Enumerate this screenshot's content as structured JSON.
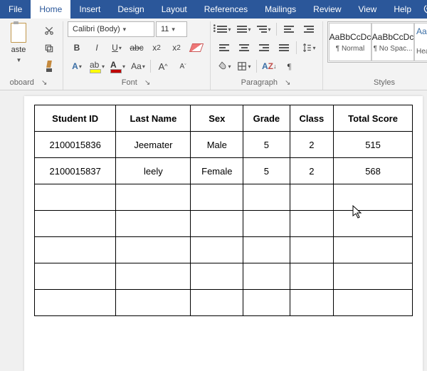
{
  "menu": {
    "file": "File",
    "home": "Home",
    "insert": "Insert",
    "design": "Design",
    "layout": "Layout",
    "references": "References",
    "mailings": "Mailings",
    "review": "Review",
    "view": "View",
    "help": "Help"
  },
  "clipboard": {
    "paste": "aste",
    "group": "oboard"
  },
  "font": {
    "name": "Calibri (Body)",
    "size": "11",
    "group": "Font"
  },
  "paragraph": {
    "group": "Paragraph"
  },
  "styles": {
    "sample": "AaBbCcDc",
    "normal": "¶ Normal",
    "nospacing": "¶ No Spac...",
    "heading_sample": "AaB",
    "heading": "Head",
    "group": "Styles"
  },
  "table": {
    "headers": [
      "Student ID",
      "Last Name",
      "Sex",
      "Grade",
      "Class",
      "Total Score"
    ],
    "rows": [
      [
        "2100015836",
        "Jeemater",
        "Male",
        "5",
        "2",
        "515"
      ],
      [
        "2100015837",
        "leely",
        "Female",
        "5",
        "2",
        "568"
      ],
      [
        "",
        "",
        "",
        "",
        "",
        ""
      ],
      [
        "",
        "",
        "",
        "",
        "",
        ""
      ],
      [
        "",
        "",
        "",
        "",
        "",
        ""
      ],
      [
        "",
        "",
        "",
        "",
        "",
        ""
      ],
      [
        "",
        "",
        "",
        "",
        "",
        ""
      ]
    ]
  }
}
